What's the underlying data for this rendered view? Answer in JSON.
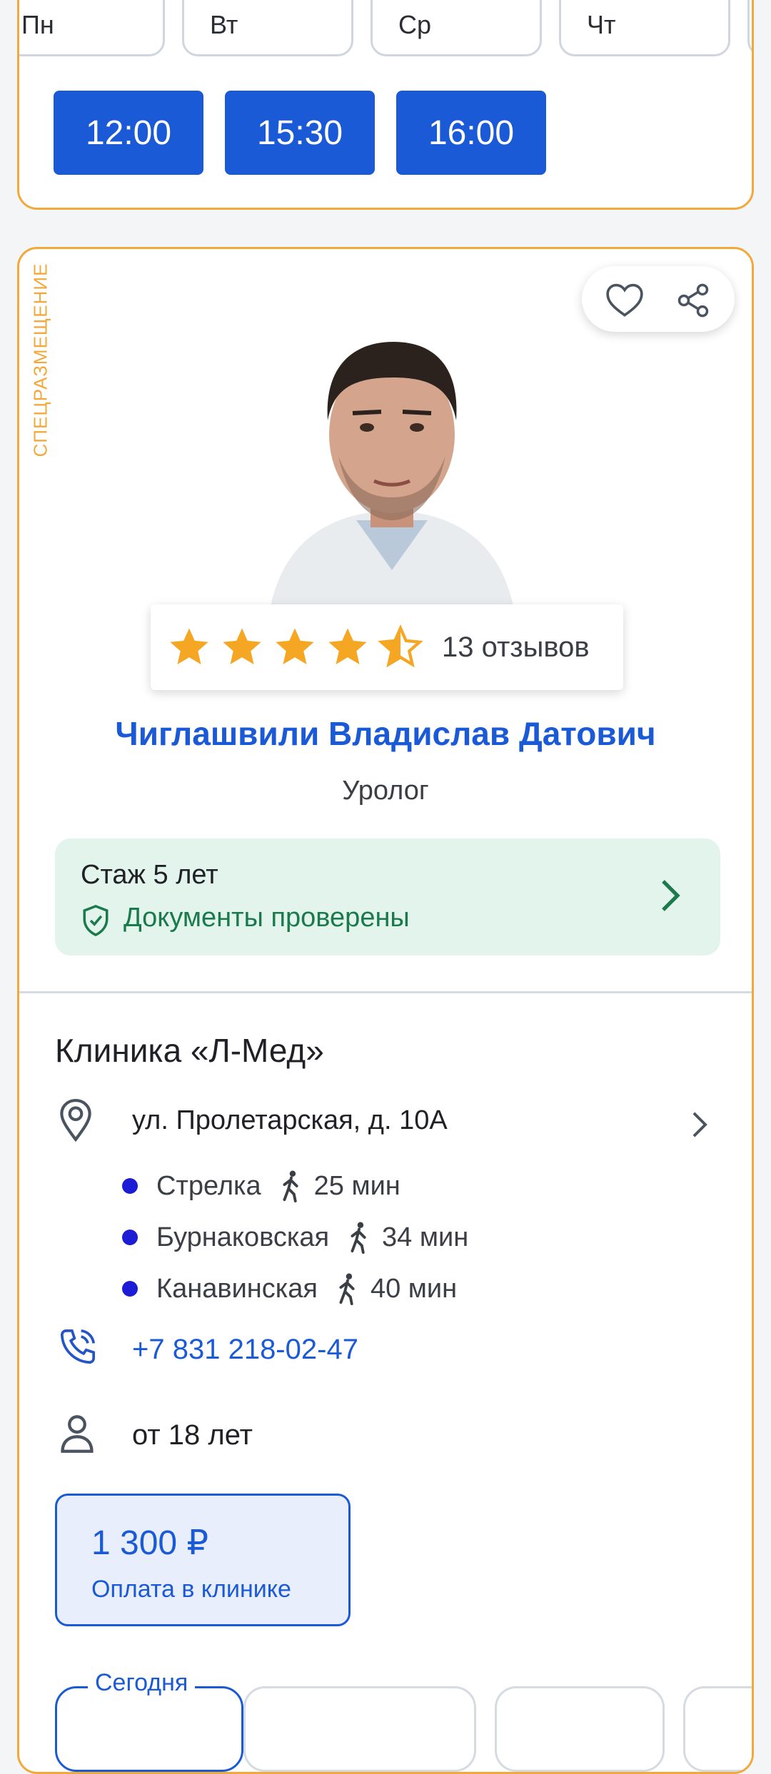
{
  "schedule": {
    "days": [
      "Пн",
      "Вт",
      "Ср",
      "Чт"
    ],
    "slots": [
      "12:00",
      "15:30",
      "16:00"
    ]
  },
  "doctor": {
    "side_label": "СПЕЦРАЗМЕЩЕНИЕ",
    "rating_stars": 4.5,
    "reviews": "13 отзывов",
    "name": "Чиглашвили Владислав Датович",
    "specialty": "Уролог",
    "experience": "Стаж 5 лет",
    "documents": "Документы проверены"
  },
  "clinic": {
    "title": "Клиника «Л-Мед»",
    "address": "ул. Пролетарская, д. 10А",
    "metro": [
      {
        "name": "Стрелка",
        "time": "25 мин"
      },
      {
        "name": "Бурнаковская",
        "time": "34 мин"
      },
      {
        "name": "Канавинская",
        "time": "40 мин"
      }
    ],
    "phone": "+7 831 218-02-47",
    "age": "от 18 лет",
    "price": "1 300 ₽",
    "payment": "Оплата в клинике",
    "today_label": "Сегодня"
  },
  "colors": {
    "accent_blue": "#1b5ad6",
    "promo_orange": "#f2a93b",
    "verified_green": "#1a7a4c",
    "metro_dot": "#1c1bd6"
  }
}
